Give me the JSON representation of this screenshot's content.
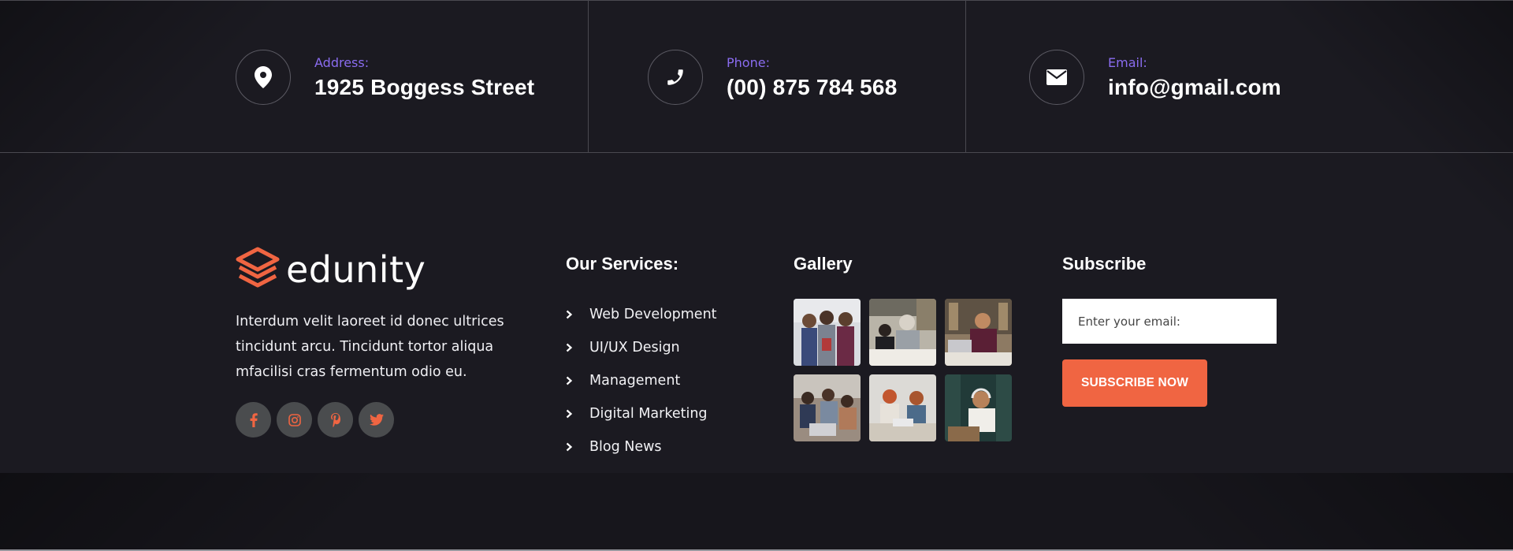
{
  "contact": [
    {
      "label": "Address:",
      "value": "1925 Boggess Street",
      "icon": "map-pin-icon"
    },
    {
      "label": "Phone:",
      "value": "(00) 875 784 568",
      "icon": "phone-icon"
    },
    {
      "label": "Email:",
      "value": "info@gmail.com",
      "icon": "envelope-icon"
    }
  ],
  "brand": {
    "name": "edunity",
    "logo_color": "#f06542"
  },
  "about": {
    "text": "Interdum velit laoreet id donec ultrices tincidunt arcu. Tincidunt tortor aliqua mfacilisi cras fermentum odio eu."
  },
  "socials": [
    {
      "icon": "facebook-icon"
    },
    {
      "icon": "instagram-icon"
    },
    {
      "icon": "pinterest-icon"
    },
    {
      "icon": "twitter-icon"
    }
  ],
  "services": {
    "title": "Our Services:",
    "items": [
      "Web Development",
      "UI/UX Design",
      "Management",
      "Digital Marketing",
      "Blog News"
    ]
  },
  "gallery": {
    "title": "Gallery",
    "images": 6
  },
  "subscribe": {
    "title": "Subscribe",
    "placeholder": "Enter your email:",
    "button": "SUBSCRIBE NOW"
  },
  "colors": {
    "accent": "#f06542",
    "label": "#8a6cf0",
    "background": "#1b1a21"
  }
}
